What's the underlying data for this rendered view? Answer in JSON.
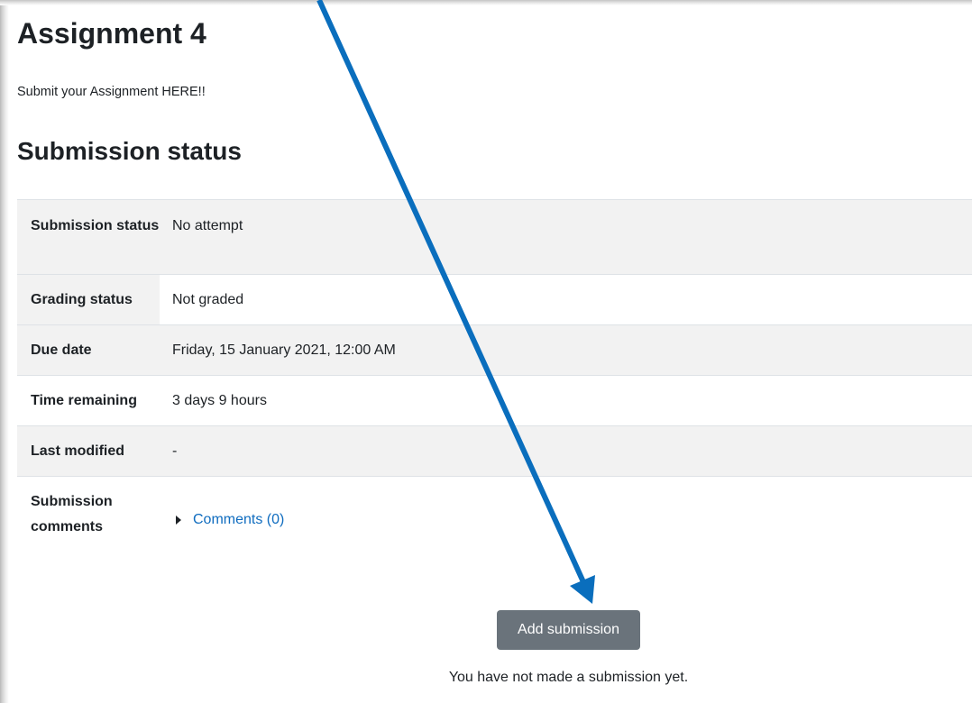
{
  "assignment": {
    "title": "Assignment 4",
    "intro": "Submit your Assignment HERE!!"
  },
  "submission_status": {
    "heading": "Submission status",
    "rows": [
      {
        "label": "Submission status",
        "value": "No attempt"
      },
      {
        "label": "Grading status",
        "value": "Not graded"
      },
      {
        "label": "Due date",
        "value": "Friday, 15 January 2021, 12:00 AM"
      },
      {
        "label": "Time remaining",
        "value": "3 days 9 hours"
      },
      {
        "label": "Last modified",
        "value": "-"
      },
      {
        "label": "Submission comments",
        "value": "Comments (0)"
      }
    ]
  },
  "actions": {
    "add_submission_label": "Add submission",
    "no_submission_text": "You have not made a submission yet."
  },
  "annotation": {
    "arrow_color": "#0a6ebd"
  },
  "colors": {
    "link": "#0f6cbf",
    "button_bg": "#6a737b",
    "row_shade": "#f2f2f2"
  },
  "icons": {
    "comments_toggle": "caret-right-icon",
    "callout": "arrow-annotation-icon"
  }
}
